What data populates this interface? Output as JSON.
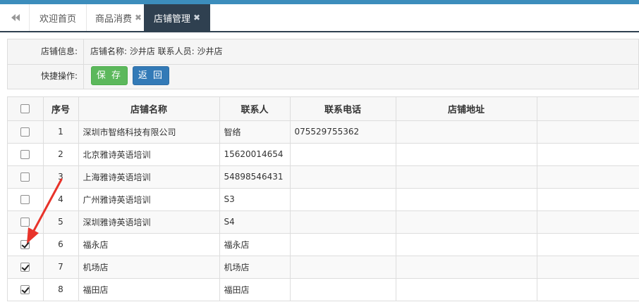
{
  "tabs": {
    "items": [
      {
        "label": "欢迎首页",
        "closable": false,
        "active": false
      },
      {
        "label": "商品消费",
        "closable": true,
        "active": false
      },
      {
        "label": "店铺管理",
        "closable": true,
        "active": true
      }
    ],
    "close_glyph": "✖",
    "back_icon": "double-left-arrow-icon"
  },
  "info": {
    "shop_info_label": "店铺信息:",
    "shop_info_value": "店铺名称: 沙井店  联系人员: 沙井店",
    "quick_ops_label": "快捷操作:",
    "save_label": "保 存",
    "back_label": "返 回"
  },
  "grid": {
    "columns": [
      "序号",
      "店铺名称",
      "联系人",
      "联系电话",
      "店铺地址"
    ],
    "rows": [
      {
        "index": "1",
        "name": "深圳市智络科技有限公司",
        "contact": "智络",
        "phone": "075529755362",
        "address": "",
        "checked": false
      },
      {
        "index": "2",
        "name": "北京雅诗英语培训",
        "contact": "15620014654",
        "phone": "",
        "address": "",
        "checked": false
      },
      {
        "index": "3",
        "name": "上海雅诗英语培训",
        "contact": "54898546431",
        "phone": "",
        "address": "",
        "checked": false
      },
      {
        "index": "4",
        "name": "广州雅诗英语培训",
        "contact": "S3",
        "phone": "",
        "address": "",
        "checked": false
      },
      {
        "index": "5",
        "name": "深圳雅诗英语培训",
        "contact": "S4",
        "phone": "",
        "address": "",
        "checked": false
      },
      {
        "index": "6",
        "name": "福永店",
        "contact": "福永店",
        "phone": "",
        "address": "",
        "checked": true
      },
      {
        "index": "7",
        "name": "机场店",
        "contact": "机场店",
        "phone": "",
        "address": "",
        "checked": true
      },
      {
        "index": "8",
        "name": "福田店",
        "contact": "福田店",
        "phone": "",
        "address": "",
        "checked": true
      }
    ]
  },
  "colors": {
    "accent_bar": "#3c8dbc",
    "active_tab": "#2f4050",
    "save_button": "#5cb85c",
    "back_button": "#337ab7",
    "annotation_arrow": "#e8332a"
  }
}
